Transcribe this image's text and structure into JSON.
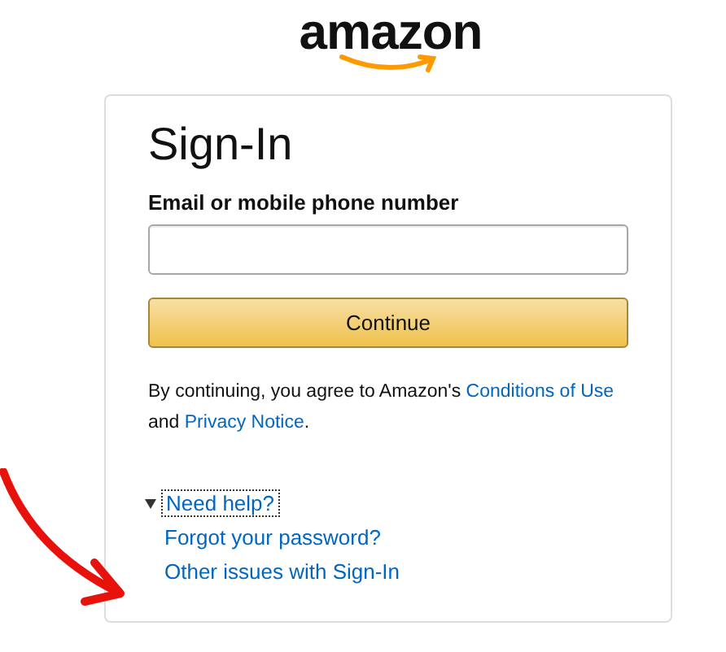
{
  "logo": {
    "text": "amazon"
  },
  "title": "Sign-In",
  "email_field": {
    "label": "Email or mobile phone number"
  },
  "continue_button": "Continue",
  "legal": [
    {
      "kind": "text",
      "text": "By continuing, you agree to Amazon's "
    },
    {
      "kind": "link",
      "text": "Conditions of Use"
    },
    {
      "kind": "text",
      "text": " and "
    },
    {
      "kind": "link",
      "text": "Privacy Notice"
    },
    {
      "kind": "text",
      "text": "."
    }
  ],
  "help": {
    "label": "Need help?",
    "expanded": true,
    "links": [
      "Forgot your password?",
      "Other issues with Sign-In"
    ]
  }
}
